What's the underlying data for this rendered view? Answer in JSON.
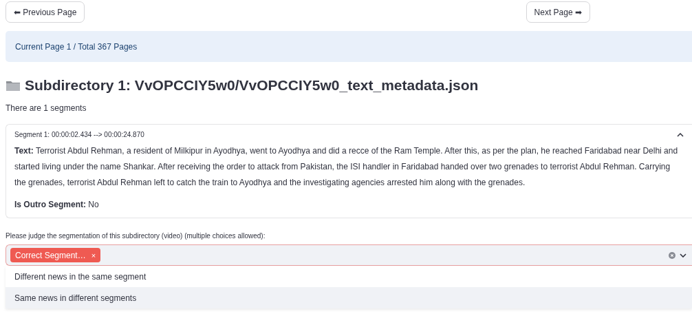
{
  "nav": {
    "previous": {
      "icon": "⬅",
      "label": "Previous Page"
    },
    "next": {
      "label": "Next Page",
      "icon": "➡"
    }
  },
  "page_info": "Current Page 1 / Total 367 Pages",
  "heading": "Subdirectory 1: VvOPCCIY5w0/VvOPCCIY5w0_text_metadata.json",
  "segment_count": "There are 1 segments",
  "segments": [
    {
      "title": "Segment 1: 00:00:02.434 --> 00:00:24.870",
      "expanded": true,
      "text": "**Text:** Terrorist Abdul Rehman, a resident of Milkipur in Ayodhya, went to Ayodhya and did a recce of the Ram Temple. After this, as per the plan, he reached Faridabad near Delhi and started living under the name Shankar. After receiving the order to attack from Pakistan, the ISI handler in Faridabad handed over two grenades to terrorist Abdul Rehman. Carrying the grenades, terrorist Abdul Rehman left to catch the train to Ayodhya and the investigating agencies arrested him along with the grenades.",
      "outro": "**Is Outro Segment:** No"
    }
  ],
  "judge": {
    "label": "Please judge the segmentation of this subdirectory (video) (multiple choices allowed):",
    "chips": [
      {
        "label": "Correct Segment…",
        "remove": "×"
      }
    ],
    "options": [
      {
        "label": "Different news in the same segment",
        "highlighted": false
      },
      {
        "label": "Same news in different segments",
        "highlighted": true
      }
    ]
  }
}
